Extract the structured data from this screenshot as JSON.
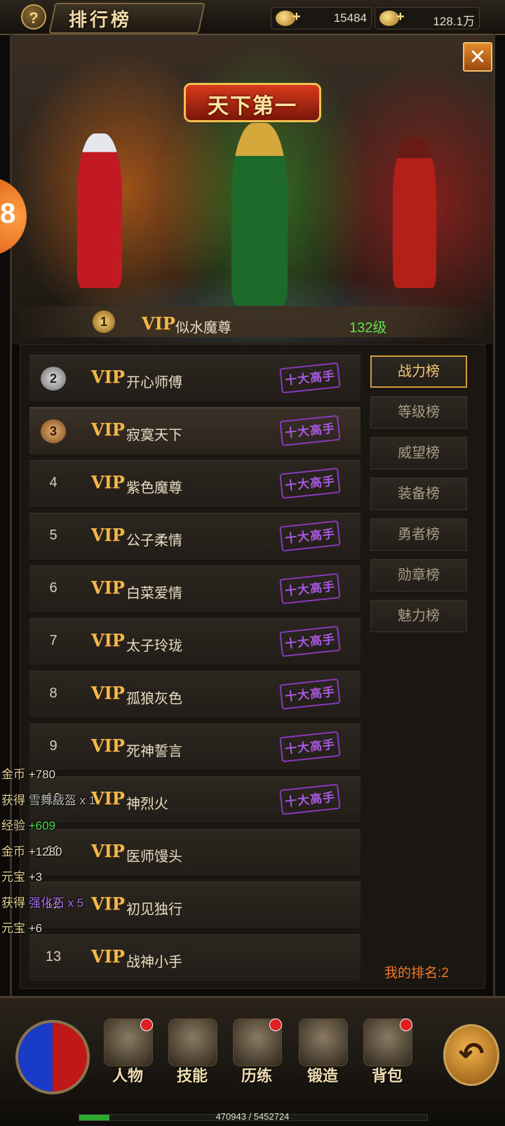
{
  "header": {
    "title": "排行榜",
    "help_icon": "?",
    "gold": "15484",
    "coins": "128.1万",
    "plus": "+"
  },
  "close_icon": "✕",
  "hero": {
    "banner": "天下第一",
    "first": {
      "rank": "1",
      "vip": "VIP",
      "name": "似水魔尊",
      "level": "132级"
    }
  },
  "ranking": {
    "rows": [
      {
        "rank": "2",
        "vip": "VIP",
        "name": "开心师傅",
        "stamp": "十大高手"
      },
      {
        "rank": "3",
        "vip": "VIP",
        "name": "寂寞天下",
        "stamp": "十大高手"
      },
      {
        "rank": "4",
        "vip": "VIP",
        "name": "紫色魔尊",
        "stamp": "十大高手"
      },
      {
        "rank": "5",
        "vip": "VIP",
        "name": "公子柔情",
        "stamp": "十大高手"
      },
      {
        "rank": "6",
        "vip": "VIP",
        "name": "白菜爱情",
        "stamp": "十大高手"
      },
      {
        "rank": "7",
        "vip": "VIP",
        "name": "太子玲珑",
        "stamp": "十大高手"
      },
      {
        "rank": "8",
        "vip": "VIP",
        "name": "孤狼灰色",
        "stamp": "十大高手"
      },
      {
        "rank": "9",
        "vip": "VIP",
        "name": "死神誓言",
        "stamp": "十大高手"
      },
      {
        "rank": "10",
        "vip": "VIP",
        "name": "神烈火",
        "stamp": "十大高手"
      },
      {
        "rank": "11",
        "vip": "VIP",
        "name": "医师馒头",
        "stamp": ""
      },
      {
        "rank": "12",
        "vip": "VIP",
        "name": "初见独行",
        "stamp": ""
      },
      {
        "rank": "13",
        "vip": "VIP",
        "name": "战神小手",
        "stamp": ""
      }
    ],
    "my_rank": "我的排名:2"
  },
  "tabs": [
    "战力榜",
    "等级榜",
    "威望榜",
    "装备榜",
    "勇者榜",
    "勋章榜",
    "魅力榜"
  ],
  "log": [
    {
      "k": "金币",
      "v": "+780",
      "color": "#e6e0c8"
    },
    {
      "k": "获得",
      "v": "雪舞战盔 x 1",
      "color": "#b8b8b8"
    },
    {
      "k": "经验",
      "v": "+609",
      "color": "#4ee04a"
    },
    {
      "k": "金币",
      "v": "+1280",
      "color": "#e6e0c8"
    },
    {
      "k": "元宝",
      "v": "+3",
      "color": "#e6e0c8"
    },
    {
      "k": "获得",
      "v": "强化石 x 5",
      "color": "#b070f0"
    },
    {
      "k": "元宝",
      "v": "+6",
      "color": "#e6e0c8"
    }
  ],
  "nav": [
    "人物",
    "技能",
    "历练",
    "锻造",
    "背包"
  ],
  "back_icon": "↶",
  "exp": {
    "text": "470943 / 5452724",
    "fraction": 0.086
  }
}
